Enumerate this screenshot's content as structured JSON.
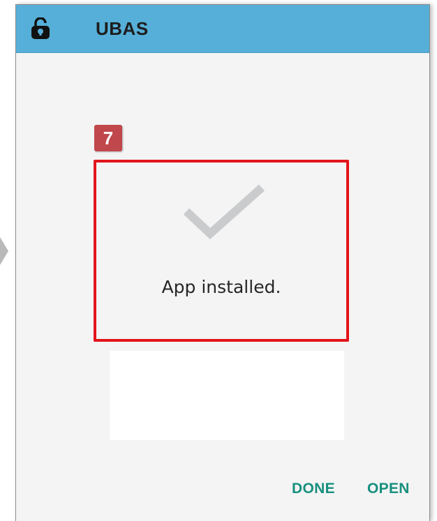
{
  "header": {
    "title": "UBAS",
    "icon": "unlocked-padlock-icon"
  },
  "annotation": {
    "step_number": "7",
    "highlight_color": "#e3141b",
    "marker_color": "#c0474b"
  },
  "status": {
    "icon": "checkmark-icon",
    "message": "App installed."
  },
  "actions": {
    "done_label": "DONE",
    "open_label": "OPEN"
  },
  "colors": {
    "titlebar": "#56afd8",
    "accent": "#17907f",
    "checkmark": "#c9cbcd"
  }
}
